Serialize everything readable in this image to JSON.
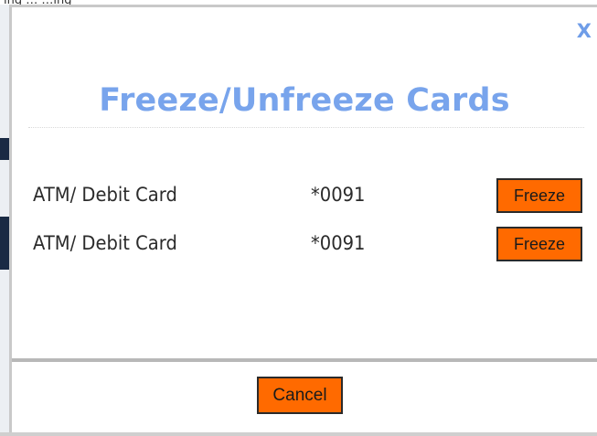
{
  "background": {
    "partial_text": "ing …           …ing"
  },
  "dialog": {
    "close_label": "X",
    "title": "Freeze/Unfreeze Cards",
    "cards": [
      {
        "name": "ATM/ Debit Card",
        "number": "*0091",
        "action_label": "Freeze"
      },
      {
        "name": "ATM/ Debit Card",
        "number": "*0091",
        "action_label": "Freeze"
      }
    ],
    "cancel_label": "Cancel"
  },
  "colors": {
    "accent_title": "#78a4ec",
    "button_bg": "#ff6a00",
    "button_border": "#2a2a2a"
  }
}
